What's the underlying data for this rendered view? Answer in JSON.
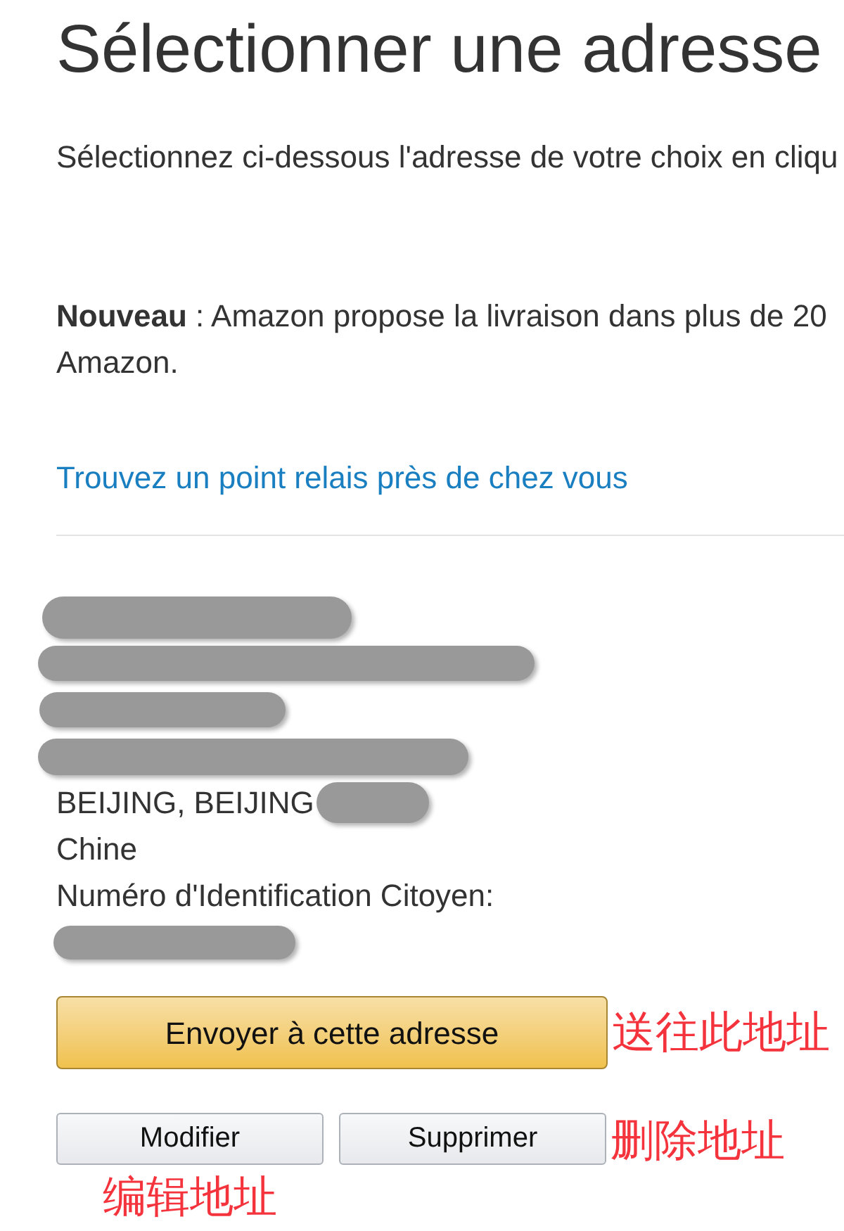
{
  "header": {
    "title": "Sélectionner une adresse",
    "instructions": "Sélectionnez ci-dessous l'adresse de votre choix en cliqu"
  },
  "notice": {
    "lines": [
      "**Nouveau** : Amazon propose la livraison dans plus de 20",
      "Amazon."
    ]
  },
  "relay_link": "Trouvez un point relais près de chez vous",
  "address": {
    "lines": [
      {
        "kind": "redacted"
      },
      {
        "kind": "redacted"
      },
      {
        "kind": "redacted"
      },
      {
        "kind": "redacted"
      },
      {
        "kind": "text",
        "text": "BEIJING, BEIJING",
        "redacted_after": true
      },
      {
        "kind": "text",
        "text": "Chine",
        "redacted_after": false
      },
      {
        "kind": "text",
        "text": "Numéro d'Identification Citoyen:",
        "redacted_after": false
      },
      {
        "kind": "redacted"
      }
    ]
  },
  "actions": {
    "primary": {
      "label": "Envoyer à cette adresse",
      "annotation": {
        "text": "送往此地址",
        "kind": "beside"
      }
    },
    "secondary": [
      {
        "label": "Modifier",
        "annotation": {
          "text": "编辑地址",
          "kind": "below"
        }
      },
      {
        "label": "Supprimer",
        "annotation": {
          "text": "删除地址",
          "kind": "beside"
        }
      }
    ]
  }
}
